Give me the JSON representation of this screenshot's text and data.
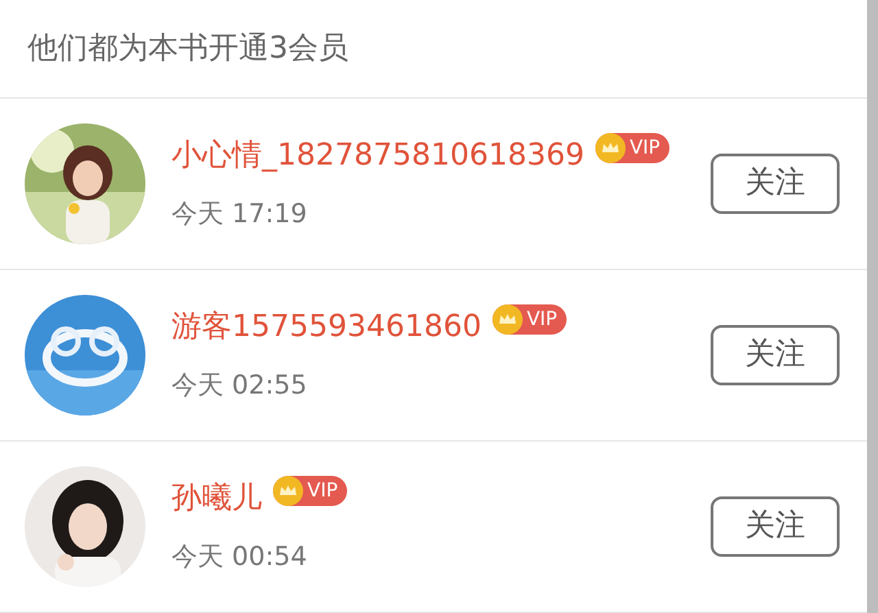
{
  "header": {
    "title": "他们都为本书开通3会员"
  },
  "members": [
    {
      "name": "小心情_1827875810618369",
      "badge": "VIP",
      "time": "今天 17:19",
      "button": "关注"
    },
    {
      "name": "游客1575593461860",
      "badge": "VIP",
      "time": "今天 02:55",
      "button": "关注"
    },
    {
      "name": "孙曦儿",
      "badge": "VIP",
      "time": "今天 00:54",
      "button": "关注"
    }
  ]
}
